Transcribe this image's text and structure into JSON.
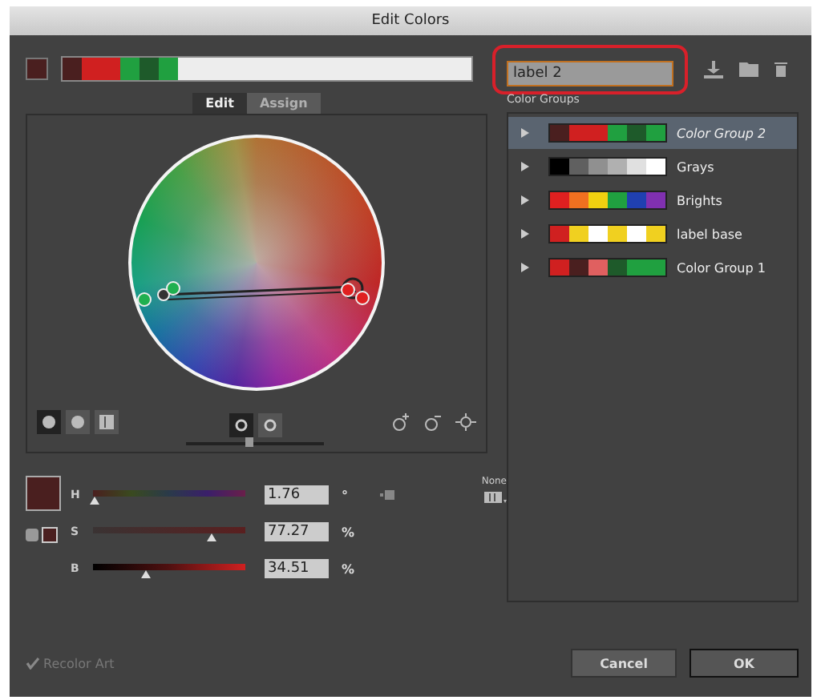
{
  "window": {
    "title": "Edit Colors"
  },
  "current_swatch": {
    "color": "#4a1f1f"
  },
  "color_strip": [
    {
      "color": "#4a1f1f"
    },
    {
      "color": "#d02020"
    },
    {
      "color": "#d02020"
    },
    {
      "color": "#20a040"
    },
    {
      "color": "#1e5a2a"
    },
    {
      "color": "#20a040"
    }
  ],
  "name_field": {
    "value": "label 2"
  },
  "tabs": [
    {
      "label": "Edit",
      "selected": true
    },
    {
      "label": "Assign",
      "selected": false
    }
  ],
  "wheel_views": [
    {
      "selected": true
    },
    {
      "selected": false
    },
    {
      "selected": false
    }
  ],
  "wheel_modes": [
    {
      "selected": true
    },
    {
      "selected": false
    }
  ],
  "brightness": {
    "level": 0.45
  },
  "sliders": [
    {
      "label": "H",
      "value": "1.76",
      "unit": "°",
      "level": 0.01,
      "kind": "hue"
    },
    {
      "label": "S",
      "value": "77.27",
      "unit": "%",
      "level": 0.78,
      "kind": "saturation"
    },
    {
      "label": "B",
      "value": "34.51",
      "unit": "%",
      "level": 0.35,
      "kind": "brightness"
    }
  ],
  "color_mode": {
    "label": "None"
  },
  "color_groups": {
    "title": "Color Groups",
    "items": [
      {
        "name": "Color Group 2",
        "selected": true,
        "swatches": [
          {
            "color": "#4a1f1f"
          },
          {
            "color": "#d02020"
          },
          {
            "color": "#d02020"
          },
          {
            "color": "#20a040"
          },
          {
            "color": "#1e5a2a"
          },
          {
            "color": "#20a040"
          }
        ]
      },
      {
        "name": "Grays",
        "selected": false,
        "swatches": [
          {
            "color": "#000000"
          },
          {
            "color": "#606060"
          },
          {
            "color": "#909090"
          },
          {
            "color": "#b0b0b0"
          },
          {
            "color": "#e0e0e0"
          },
          {
            "color": "#ffffff"
          }
        ]
      },
      {
        "name": "Brights",
        "selected": false,
        "swatches": [
          {
            "color": "#e02020"
          },
          {
            "color": "#f07020"
          },
          {
            "color": "#f0d010"
          },
          {
            "color": "#20a040"
          },
          {
            "color": "#2040b0"
          },
          {
            "color": "#8030b0"
          }
        ]
      },
      {
        "name": "label base",
        "selected": false,
        "swatches": [
          {
            "color": "#d02020"
          },
          {
            "color": "#f0d020"
          },
          {
            "color": "#ffffff"
          },
          {
            "color": "#f0d020"
          },
          {
            "color": "#ffffff"
          },
          {
            "color": "#f0d020"
          }
        ]
      },
      {
        "name": "Color Group 1",
        "selected": false,
        "swatches": [
          {
            "color": "#d02020"
          },
          {
            "color": "#4a1f1f"
          },
          {
            "color": "#e06060"
          },
          {
            "color": "#1e5a2a"
          },
          {
            "color": "#20a040"
          },
          {
            "color": "#20a040"
          }
        ]
      }
    ]
  },
  "recolor_art": {
    "label": "Recolor Art",
    "checked": true
  },
  "buttons": [
    {
      "label": "Cancel",
      "kind": "secondary"
    },
    {
      "label": "OK",
      "kind": "primary"
    }
  ]
}
